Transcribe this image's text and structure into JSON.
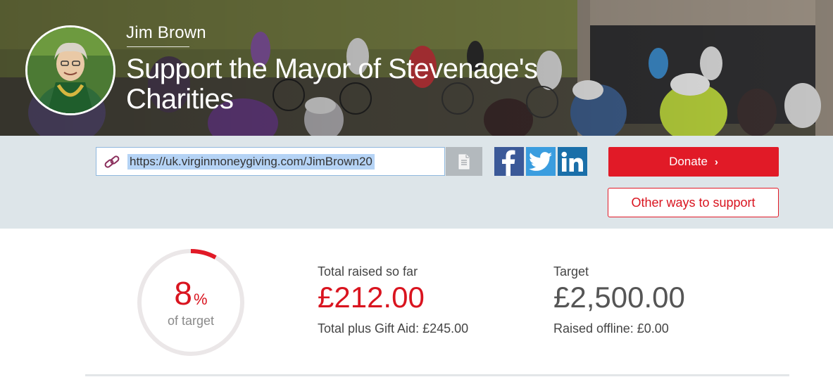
{
  "header": {
    "owner_name": "Jim Brown",
    "title": "Support the Mayor of Stevenage's Charities"
  },
  "share": {
    "page_url": "https://uk.virginmoneygiving.com/JimBrown20",
    "icons": [
      "link-icon",
      "copy-document-icon",
      "facebook-icon",
      "twitter-icon",
      "linkedin-icon"
    ]
  },
  "actions": {
    "donate_label": "Donate",
    "donate_chevron": "›",
    "other_ways_label": "Other ways to support"
  },
  "progress": {
    "percent": 8,
    "percent_display": "8",
    "percent_symbol": "%",
    "of_target_label": "of target"
  },
  "stats": {
    "raised_label": "Total raised so far",
    "raised_amount": "£212.00",
    "gift_aid_text": "Total plus Gift Aid: £245.00",
    "target_label": "Target",
    "target_amount": "£2,500.00",
    "offline_text": "Raised offline: £0.00"
  },
  "colors": {
    "brand_red": "#e11a27",
    "share_bar_bg": "#dde5e9",
    "facebook": "#3b5998",
    "twitter": "#3a9ddf",
    "linkedin": "#1a6fa9"
  }
}
